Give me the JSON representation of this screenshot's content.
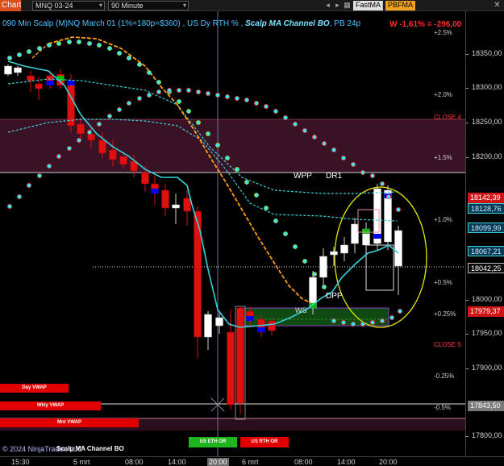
{
  "toolbar": {
    "tab_label": "Chart",
    "instrument": "MNQ 03-24",
    "interval": "90 Minute",
    "btn_fastma": "FastMA",
    "btn_pbfma": "PBFMA",
    "close_glyph": "✕"
  },
  "header": {
    "title": "090 Min Scalp (M)NQ March 01 (1%=180p=$360) , US Dy RTH % ,",
    "strategy": "Scalp MA Channel BO",
    "suffix": ", PB 24p",
    "pnl": "W -1,61% = -296,00"
  },
  "levels": {
    "plus25": "+2.5%",
    "plus20": "+2.0%",
    "close4": "CLOSE 4",
    "plus15": "+1.5%",
    "plus10": "+1.0%",
    "plus05": "+0.5%",
    "plus025": "+0.25%",
    "close5": "CLOSE 5",
    "minus025": "-0.25%",
    "minus05": "-0.5%"
  },
  "annotations": {
    "wpp": "WPP",
    "dr1": "DR1",
    "dpp": "DPP",
    "ws": "WS"
  },
  "vwap_tags": {
    "day": "Day VWAP",
    "wkly": "Wkly VWAP",
    "mnt": "Mnt VWAP"
  },
  "session_tags": {
    "eth": "US ETH OR",
    "rth": "US RTH OR"
  },
  "footer": {
    "copyright": "© 2024 NinjaTrader, LLC",
    "strategy": "Scalp MA Channel BO"
  },
  "price_axis": {
    "ticks": [
      "18350,00",
      "18300,00",
      "18250,00",
      "18200,00",
      "18150,00",
      "18100,00",
      "18050,00",
      "18000,00",
      "17950,00",
      "17900,00",
      "17850,00",
      "17800,00"
    ],
    "tags": {
      "t1": "18142,39",
      "t2": "18128,76",
      "t3": "18099,99",
      "t4": "18067,21",
      "t5": "18042,25",
      "t6": "17979,37",
      "t7": "17843,50"
    }
  },
  "time_axis": {
    "labels": [
      "15:30",
      "5 mrt",
      "08:00",
      "14:00",
      "20:00",
      "6 mrt",
      "08:00",
      "14:00",
      "20:00"
    ]
  },
  "colors": {
    "background": "#000000",
    "bull_candle": "#ffffff",
    "bear_candle": "#e01010",
    "ma_fast": "#39d0d8",
    "dot_fill": "#35e7ef",
    "close_zone": "#3a1226",
    "ws_zone": "#0f4a12",
    "ellipse": "#e8e800",
    "pnl": "#ff2d2d"
  }
}
